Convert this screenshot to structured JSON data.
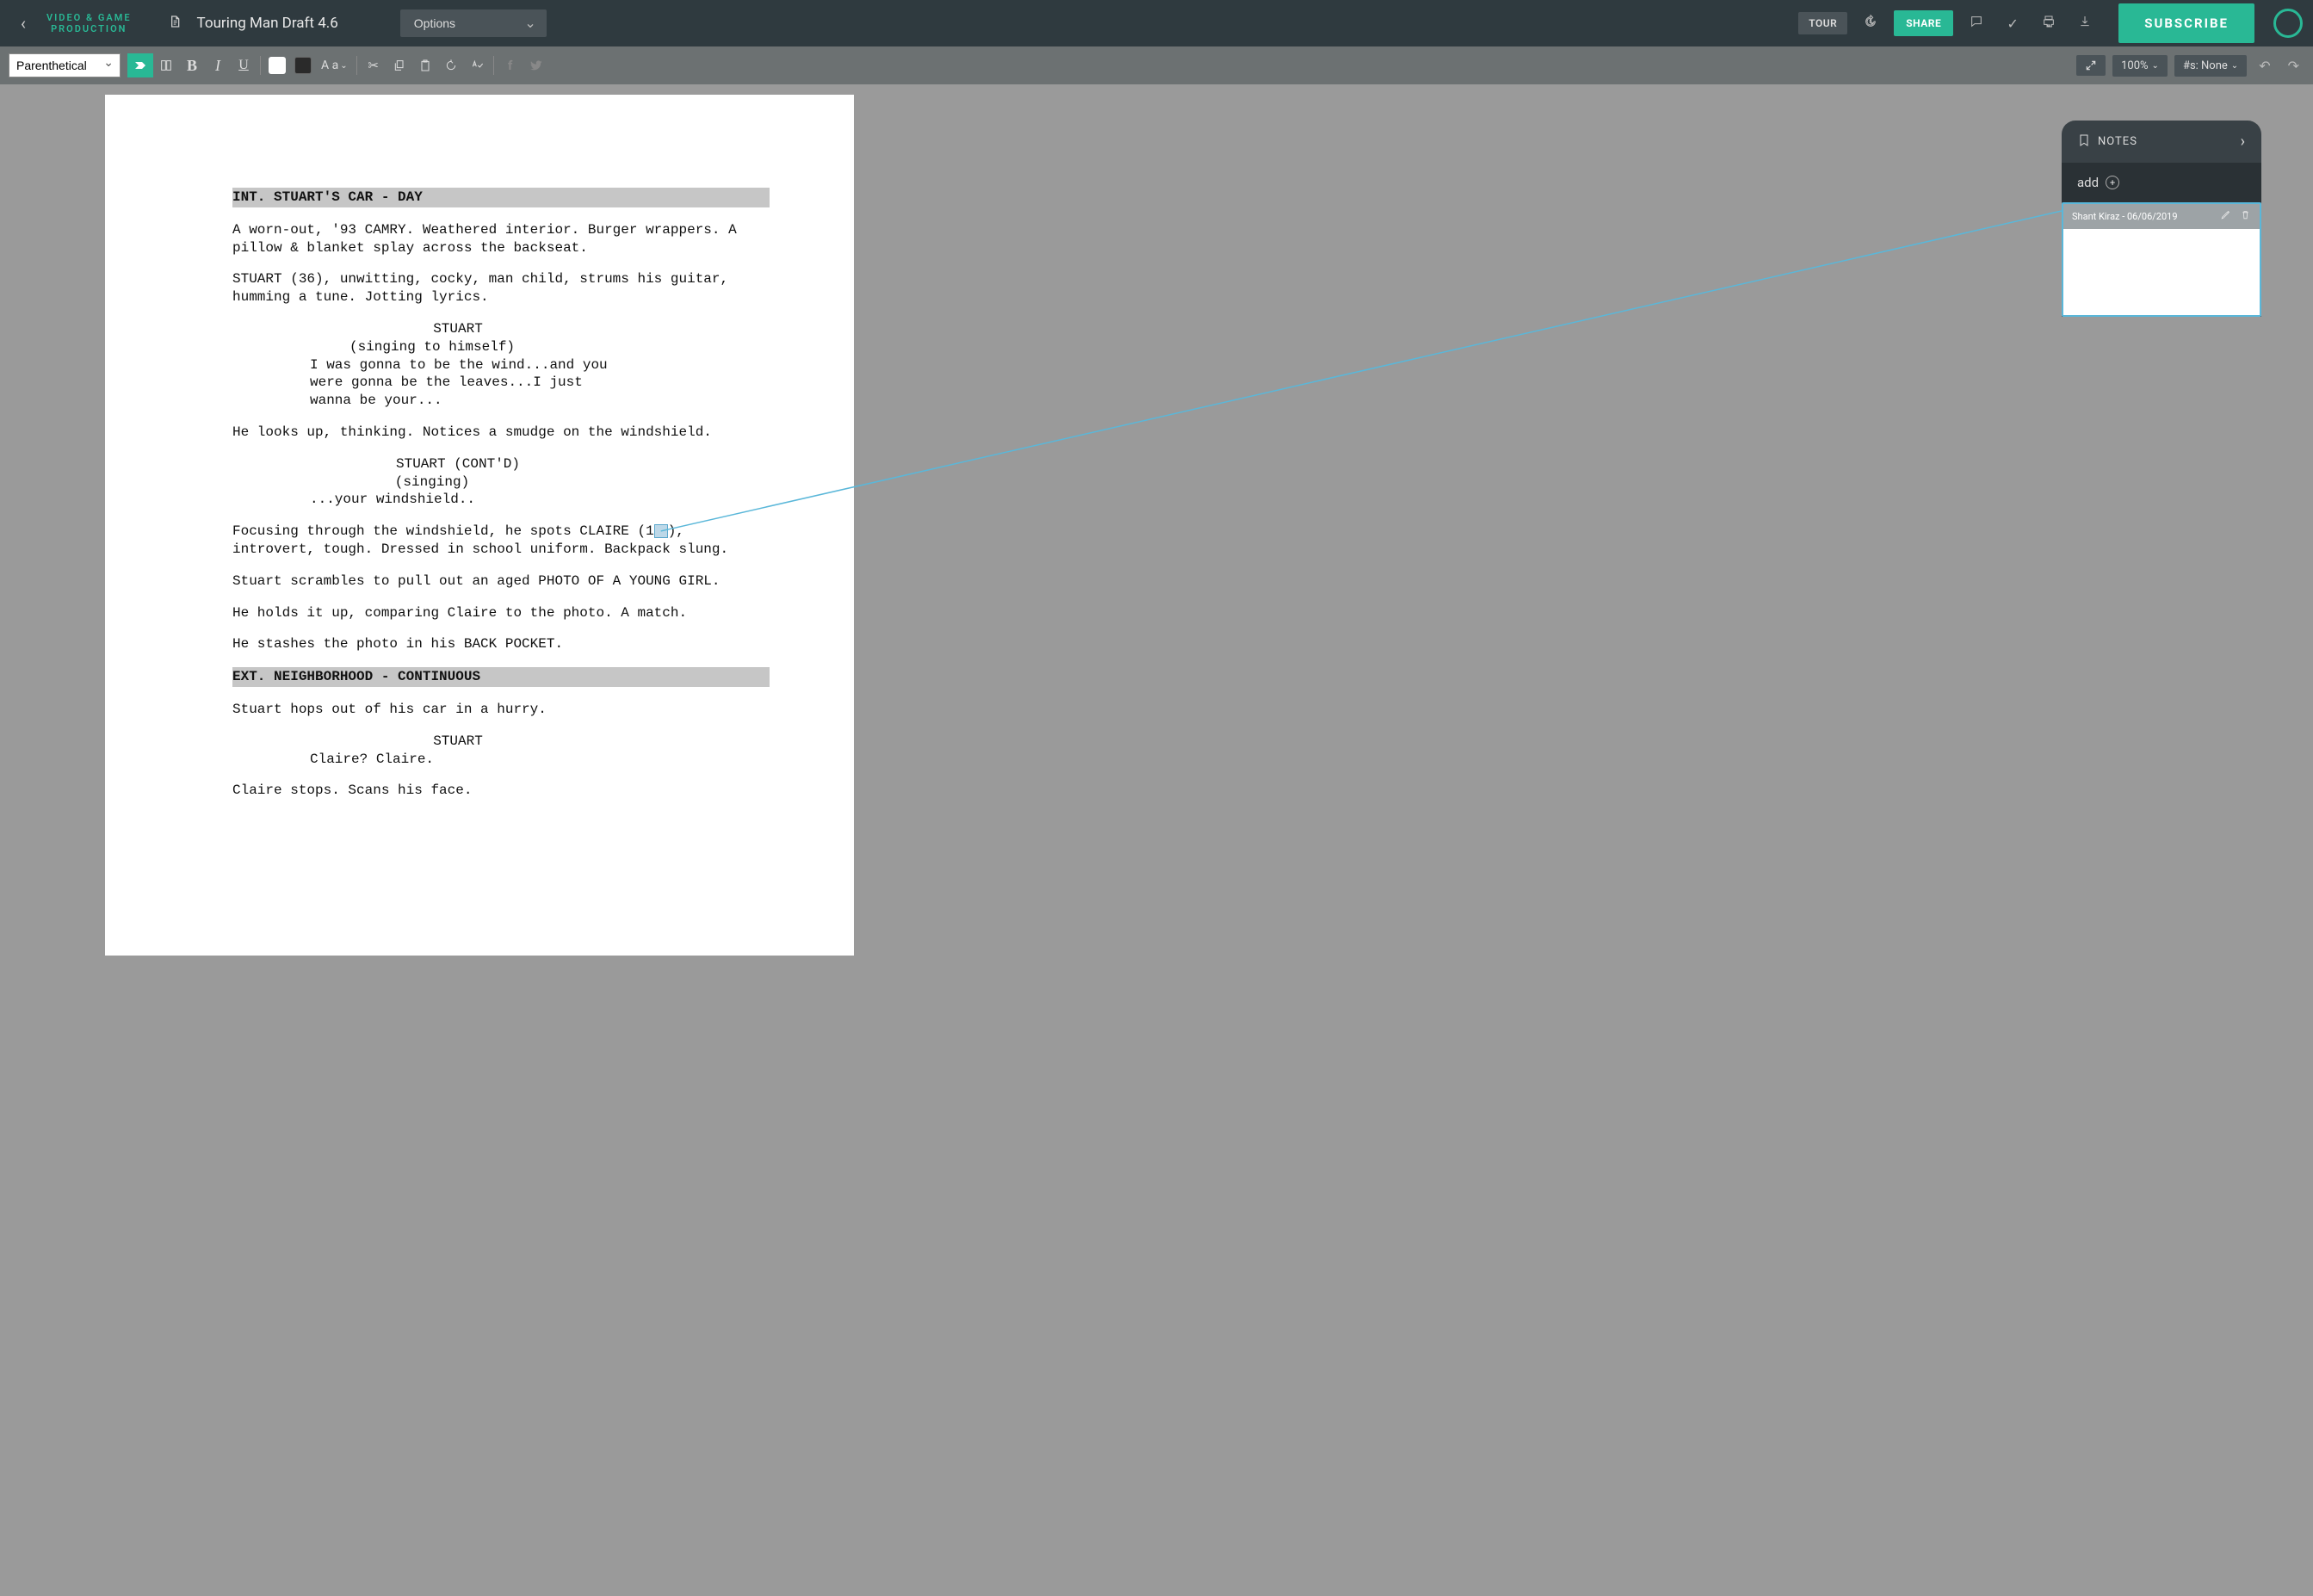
{
  "brand_line1": "VIDEO & GAME",
  "brand_line2": "PRODUCTION",
  "doc_title": "Touring Man Draft 4.6",
  "options_label": "Options",
  "tour_label": "TOUR",
  "share_label": "SHARE",
  "subscribe_label": "SUBSCRIBE",
  "element_type": "Parenthetical",
  "aa_label": "A a",
  "zoom_value": "100%",
  "scene_numbers": "#s: None",
  "notes": {
    "title": "NOTES",
    "add_label": "add",
    "meta": "Shant Kiraz - 06/06/2019"
  },
  "script": {
    "slug1": "INT. STUART'S CAR - DAY",
    "a1": "A worn-out, '93 CAMRY. Weathered interior. Burger wrappers. A pillow & blanket splay across the backseat.",
    "a2": "STUART (36), unwitting, cocky, man child, strums his guitar, humming a tune. Jotting lyrics.",
    "c1": "STUART",
    "p1": "(singing to himself)",
    "d1": "I was gonna to be the wind...and you were gonna be the leaves...I just wanna be your...",
    "a3": "He looks up, thinking. Notices a smudge on the windshield.",
    "c2": "STUART (CONT'D)",
    "p2": "(singing)",
    "d2": "...your windshield..",
    "a4a": "Focusing through the windshield, he spots CLAIRE (1",
    "a4b": "), introvert, tough. Dressed in school uniform. Backpack slung.",
    "a4_anchor": "7",
    "a5": "Stuart scrambles to pull out an aged PHOTO OF A YOUNG GIRL.",
    "a6": "He holds it up, comparing Claire to the photo. A match.",
    "a7": "He stashes the photo in his BACK POCKET.",
    "slug2": "EXT. NEIGHBORHOOD - CONTINUOUS",
    "a8": "Stuart hops out of his car in a hurry.",
    "c3": "STUART",
    "d3": "Claire? Claire.",
    "a9": "Claire stops. Scans his face."
  }
}
